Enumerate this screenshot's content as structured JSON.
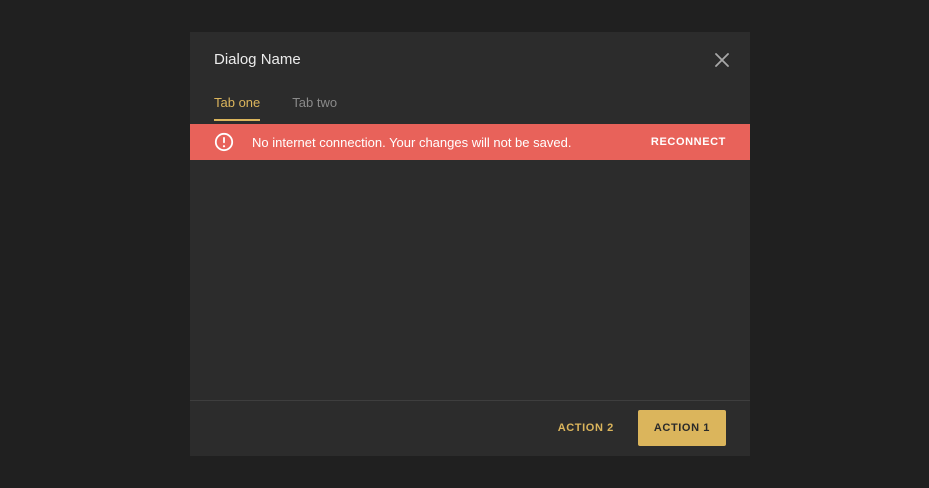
{
  "dialog": {
    "title": "Dialog Name",
    "close_icon": "close-icon"
  },
  "tabs": [
    {
      "label": "Tab one",
      "active": true
    },
    {
      "label": "Tab two",
      "active": false
    }
  ],
  "banner": {
    "icon": "alert-circle-icon",
    "message": "No internet connection. Your changes will not be saved.",
    "action_label": "RECONNECT",
    "color": "#e8625a"
  },
  "footer": {
    "secondary_label": "ACTION 2",
    "primary_label": "ACTION 1"
  },
  "colors": {
    "accent": "#dbb55c",
    "background": "#202020",
    "surface": "#2c2c2c"
  }
}
